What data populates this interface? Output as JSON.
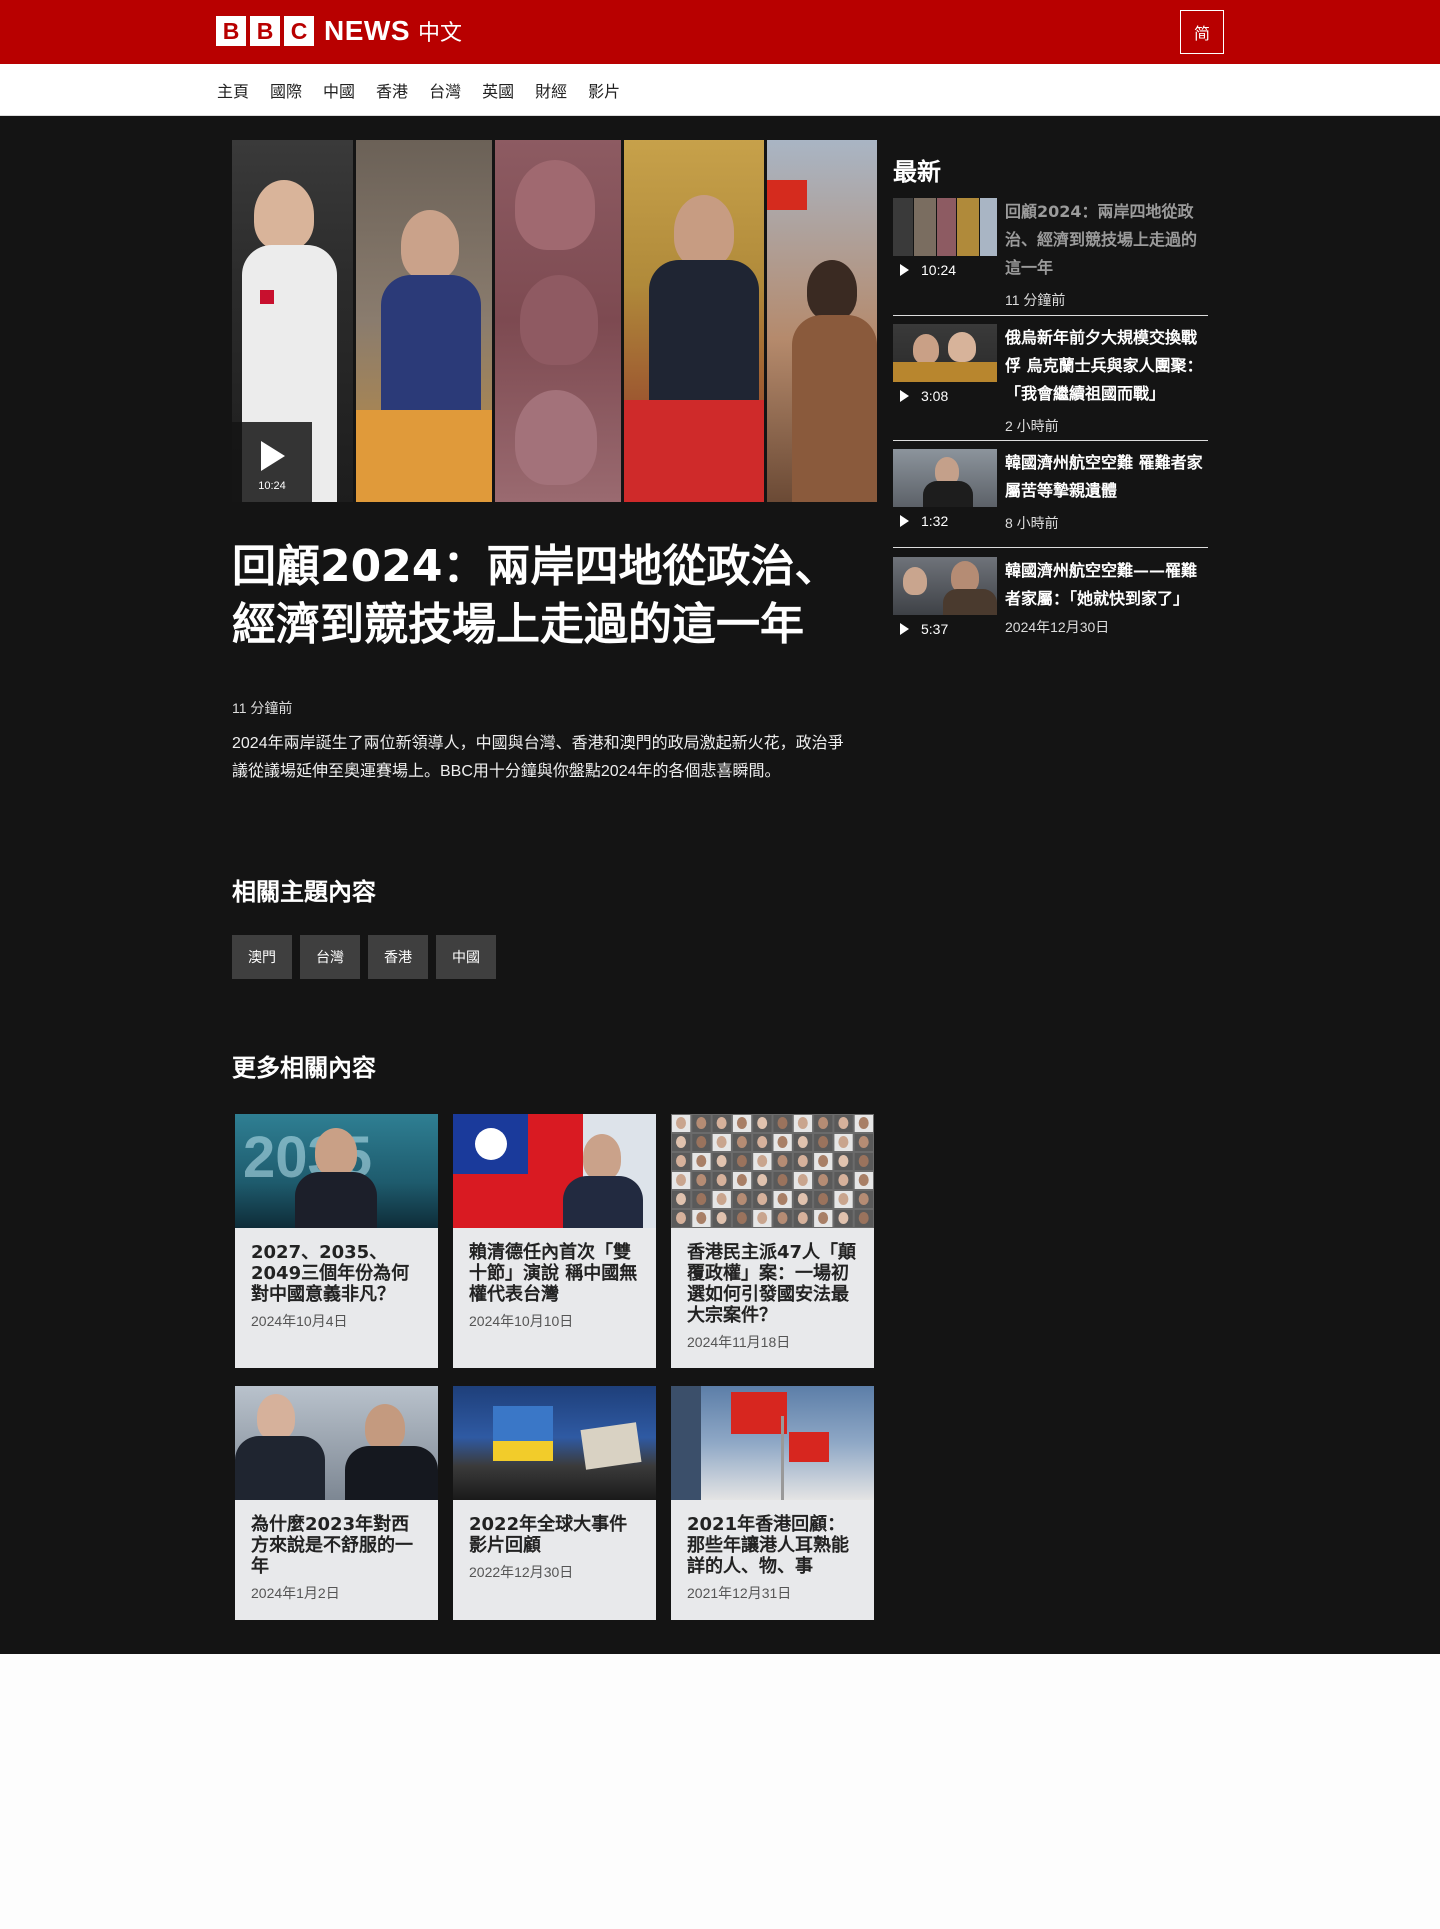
{
  "header": {
    "logo_letters": [
      "B",
      "B",
      "C"
    ],
    "logo_news": "NEWS",
    "logo_lang": "中文",
    "lang_toggle": "简"
  },
  "nav": {
    "items": [
      "主頁",
      "國際",
      "中國",
      "香港",
      "台灣",
      "英國",
      "財經",
      "影片"
    ]
  },
  "hero": {
    "duration": "10:24",
    "headline": "回顧2024：兩岸四地從政治、經濟到競技場上走過的這一年",
    "time": "11 分鐘前",
    "summary": "2024年兩岸誕生了兩位新領導人，中國與台灣、香港和澳門的政局激起新火花，政治爭議從議場延伸至奧運賽場上。BBC用十分鐘與你盤點2024年的各個悲喜瞬間。"
  },
  "related_topics": {
    "title": "相關主題內容",
    "tags": [
      "澳門",
      "台灣",
      "香港",
      "中國"
    ]
  },
  "more_related": {
    "title": "更多相關內容",
    "cards": [
      {
        "title": "2027、2035、2049三個年份為何對中國意義非凡？",
        "date": "2024年10月4日"
      },
      {
        "title": "賴清德任內首次「雙十節」演說 稱中國無權代表台灣",
        "date": "2024年10月10日"
      },
      {
        "title": "香港民主派47人「顛覆政權」案：一場初選如何引發國安法最大宗案件？",
        "date": "2024年11月18日"
      },
      {
        "title": "為什麼2023年對西方來說是不舒服的一年",
        "date": "2024年1月2日"
      },
      {
        "title": "2022年全球大事件影片回顧",
        "date": "2022年12月30日"
      },
      {
        "title": "2021年香港回顧：那些年讓港人耳熟能詳的人、物、事",
        "date": "2021年12月31日"
      }
    ]
  },
  "latest": {
    "title": "最新",
    "items": [
      {
        "title": "回顧2024：兩岸四地從政治、經濟到競技場上走過的這一年",
        "duration": "10:24",
        "time": "11 分鐘前"
      },
      {
        "title": "俄烏新年前夕大規模交換戰俘 烏克蘭士兵與家人團聚：「我會繼續祖國而戰」",
        "duration": "3:08",
        "time": "2 小時前"
      },
      {
        "title": "韓國濟州航空空難 罹難者家屬苦等摯親遺體",
        "duration": "1:32",
        "time": "8 小時前"
      },
      {
        "title": "韓國濟州航空空難——罹難者家屬：「她就快到家了」",
        "duration": "5:37",
        "time": "2024年12月30日"
      }
    ]
  },
  "colors": {
    "brand_red": "#b80000",
    "page_dark": "#141414",
    "card_bg": "#e8e9eb",
    "tag_bg": "#3f3f3f"
  }
}
